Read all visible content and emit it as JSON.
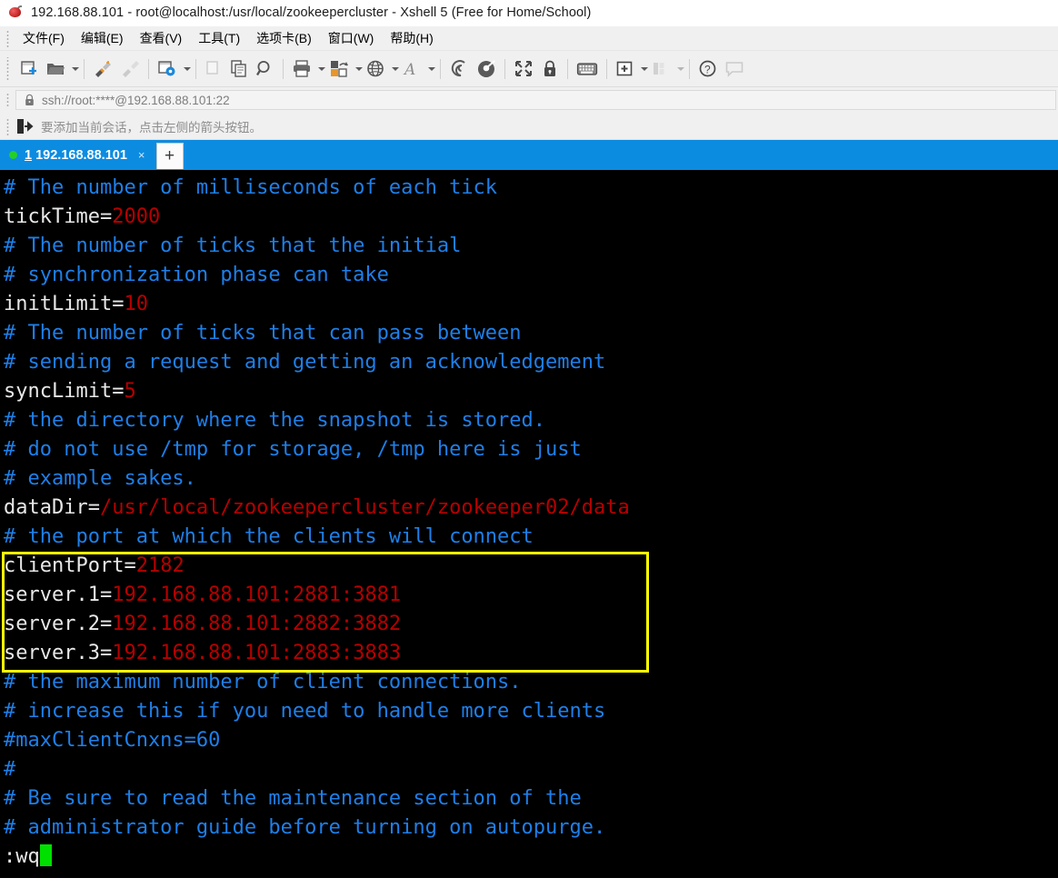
{
  "window": {
    "title": "192.168.88.101 - root@localhost:/usr/local/zookeepercluster - Xshell 5 (Free for Home/School)",
    "app_icon": "xshell-icon"
  },
  "menubar": {
    "items": [
      {
        "label": "文件(F)",
        "text": "文件",
        "mnemonic": "F"
      },
      {
        "label": "编辑(E)",
        "text": "编辑",
        "mnemonic": "E"
      },
      {
        "label": "查看(V)",
        "text": "查看",
        "mnemonic": "V"
      },
      {
        "label": "工具(T)",
        "text": "工具",
        "mnemonic": "T"
      },
      {
        "label": "选项卡(B)",
        "text": "选项卡",
        "mnemonic": "B"
      },
      {
        "label": "窗口(W)",
        "text": "窗口",
        "mnemonic": "W"
      },
      {
        "label": "帮助(H)",
        "text": "帮助",
        "mnemonic": "H"
      }
    ]
  },
  "toolbar": {
    "buttons": [
      {
        "name": "new-session-icon",
        "enabled": true,
        "caret": false
      },
      {
        "name": "open-folder-icon",
        "enabled": true,
        "caret": true
      },
      {
        "name": "connect-icon",
        "enabled": true,
        "caret": false
      },
      {
        "name": "disconnect-icon",
        "enabled": false,
        "caret": false
      },
      {
        "name": "session-properties-icon",
        "enabled": true,
        "caret": true
      },
      {
        "name": "copy-icon",
        "enabled": false,
        "caret": false
      },
      {
        "name": "paste-icon",
        "enabled": true,
        "caret": false
      },
      {
        "name": "find-icon",
        "enabled": true,
        "caret": false
      },
      {
        "name": "print-icon",
        "enabled": true,
        "caret": true
      },
      {
        "name": "file-transfer-icon",
        "enabled": true,
        "caret": true
      },
      {
        "name": "globe-icon",
        "enabled": true,
        "caret": true
      },
      {
        "name": "font-icon",
        "enabled": true,
        "caret": true
      },
      {
        "name": "compose-icon",
        "enabled": true,
        "caret": false
      },
      {
        "name": "highlight-icon",
        "enabled": true,
        "caret": false
      },
      {
        "name": "fullscreen-icon",
        "enabled": true,
        "caret": false
      },
      {
        "name": "lock-icon",
        "enabled": true,
        "caret": false
      },
      {
        "name": "keyboard-icon",
        "enabled": true,
        "caret": false
      },
      {
        "name": "add-folder-icon",
        "enabled": true,
        "caret": true
      },
      {
        "name": "layout-icon",
        "enabled": false,
        "caret": true
      },
      {
        "name": "help-icon",
        "enabled": true,
        "caret": false
      },
      {
        "name": "chat-icon",
        "enabled": false,
        "caret": false
      }
    ]
  },
  "address_bar": {
    "icon": "lock-icon",
    "value": "ssh://root:****@192.168.88.101:22"
  },
  "hint_bar": {
    "icon": "add-session-arrow-icon",
    "text": "要添加当前会话，点击左侧的箭头按钮。"
  },
  "tabs": {
    "active": {
      "status_dot": "connected-dot",
      "number": "1",
      "label": "192.168.88.101",
      "close_label": "×"
    },
    "new_tab_label": "+"
  },
  "terminal": {
    "background": "#000000",
    "comment_color": "#1e7fe8",
    "value_color": "#b60000",
    "text_color": "#e8e8e8",
    "highlight_color": "#ffff00",
    "cursor_color": "#00e000",
    "lines": [
      {
        "type": "comment",
        "text": "# The number of milliseconds of each tick"
      },
      {
        "type": "kv",
        "key": "tickTime=",
        "value": "2000"
      },
      {
        "type": "comment",
        "text": "# The number of ticks that the initial"
      },
      {
        "type": "comment",
        "text": "# synchronization phase can take"
      },
      {
        "type": "kv",
        "key": "initLimit=",
        "value": "10"
      },
      {
        "type": "comment",
        "text": "# The number of ticks that can pass between"
      },
      {
        "type": "comment",
        "text": "# sending a request and getting an acknowledgement"
      },
      {
        "type": "kv",
        "key": "syncLimit=",
        "value": "5"
      },
      {
        "type": "comment",
        "text": "# the directory where the snapshot is stored."
      },
      {
        "type": "comment",
        "text": "# do not use /tmp for storage, /tmp here is just"
      },
      {
        "type": "comment",
        "text": "# example sakes."
      },
      {
        "type": "kv",
        "key": "dataDir=",
        "value": "/usr/local/zookeepercluster/zookeeper02/data"
      },
      {
        "type": "comment",
        "text": "# the port at which the clients will connect"
      },
      {
        "type": "kv",
        "key": "clientPort=",
        "value": "2182",
        "highlighted": true
      },
      {
        "type": "kv",
        "key": "server.1=",
        "value": "192.168.88.101:2881:3881",
        "highlighted": true
      },
      {
        "type": "kv",
        "key": "server.2=",
        "value": "192.168.88.101:2882:3882",
        "highlighted": true
      },
      {
        "type": "kv",
        "key": "server.3=",
        "value": "192.168.88.101:2883:3883",
        "highlighted": true
      },
      {
        "type": "comment",
        "text": "# the maximum number of client connections."
      },
      {
        "type": "comment",
        "text": "# increase this if you need to handle more clients"
      },
      {
        "type": "comment",
        "text": "#maxClientCnxns=60"
      },
      {
        "type": "comment",
        "text": "#"
      },
      {
        "type": "comment",
        "text": "# Be sure to read the maintenance section of the"
      },
      {
        "type": "comment",
        "text": "# administrator guide before turning on autopurge."
      },
      {
        "type": "command",
        "text": ":wq",
        "cursor": true
      }
    ]
  }
}
